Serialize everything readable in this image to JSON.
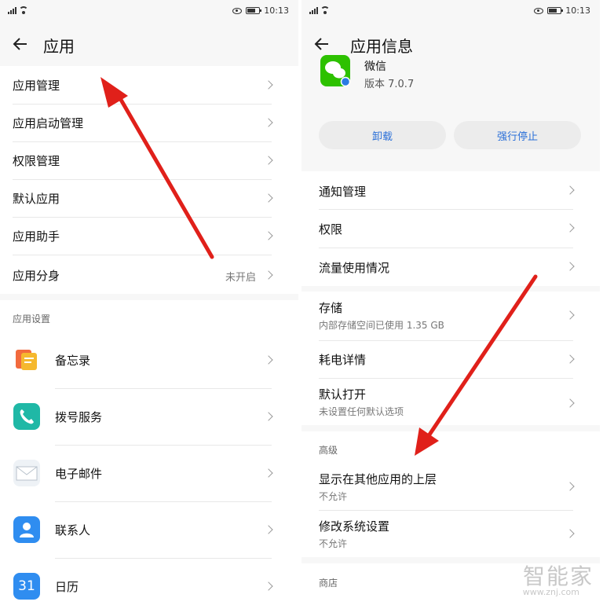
{
  "status": {
    "time": "10:13"
  },
  "left": {
    "title": "应用",
    "menu": [
      {
        "label": "应用管理"
      },
      {
        "label": "应用启动管理"
      },
      {
        "label": "权限管理"
      },
      {
        "label": "默认应用"
      },
      {
        "label": "应用助手"
      },
      {
        "label": "应用分身",
        "value": "未开启"
      }
    ],
    "section_title": "应用设置",
    "apps": [
      {
        "label": "备忘录",
        "icon": "memo-icon",
        "color": "#f5a623"
      },
      {
        "label": "拨号服务",
        "icon": "phone-icon",
        "color": "#1fb8a6"
      },
      {
        "label": "电子邮件",
        "icon": "mail-icon",
        "color": "#dfe6ee"
      },
      {
        "label": "联系人",
        "icon": "contacts-icon",
        "color": "#2f8df0"
      },
      {
        "label": "日历",
        "icon": "calendar-icon",
        "color": "#2f8df0",
        "text": "31"
      }
    ]
  },
  "right": {
    "title": "应用信息",
    "app_name": "微信",
    "version": "版本 7.0.7",
    "uninstall_label": "卸载",
    "force_stop_label": "强行停止",
    "items": [
      {
        "label": "通知管理"
      },
      {
        "label": "权限"
      },
      {
        "label": "流量使用情况"
      }
    ],
    "storage": {
      "label": "存储",
      "sub": "内部存储空间已使用 1.35 GB"
    },
    "power": {
      "label": "耗电详情"
    },
    "default_open": {
      "label": "默认打开",
      "sub": "未设置任何默认选项"
    },
    "advanced_title": "高级",
    "overlay": {
      "label": "显示在其他应用的上层",
      "sub": "不允许"
    },
    "modify": {
      "label": "修改系统设置",
      "sub": "不允许"
    },
    "store_title": "商店"
  },
  "watermark": {
    "brand": "智能家",
    "url": "www.znj.com"
  },
  "colors": {
    "accent": "#2a6fd8",
    "annotation": "#e0201a",
    "wechat": "#2dc100"
  }
}
